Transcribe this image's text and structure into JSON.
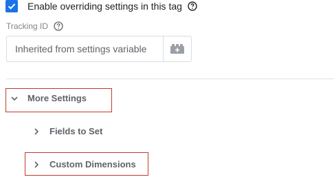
{
  "override": {
    "checked": true,
    "label": "Enable overriding settings in this tag",
    "help_icon": "help-circle-icon"
  },
  "tracking": {
    "label": "Tracking ID",
    "help_icon": "help-circle-icon",
    "value": "Inherited from settings variable",
    "variable_icon": "variable-brick-icon"
  },
  "sections": {
    "more_settings": {
      "label": "More Settings",
      "expanded": true,
      "icon": "chevron-down-icon"
    },
    "fields_to_set": {
      "label": "Fields to Set",
      "expanded": false,
      "icon": "chevron-right-icon"
    },
    "custom_dimensions": {
      "label": "Custom Dimensions",
      "expanded": false,
      "icon": "chevron-right-icon"
    }
  },
  "colors": {
    "accent": "#1a73e8",
    "highlight": "#c0392b"
  }
}
